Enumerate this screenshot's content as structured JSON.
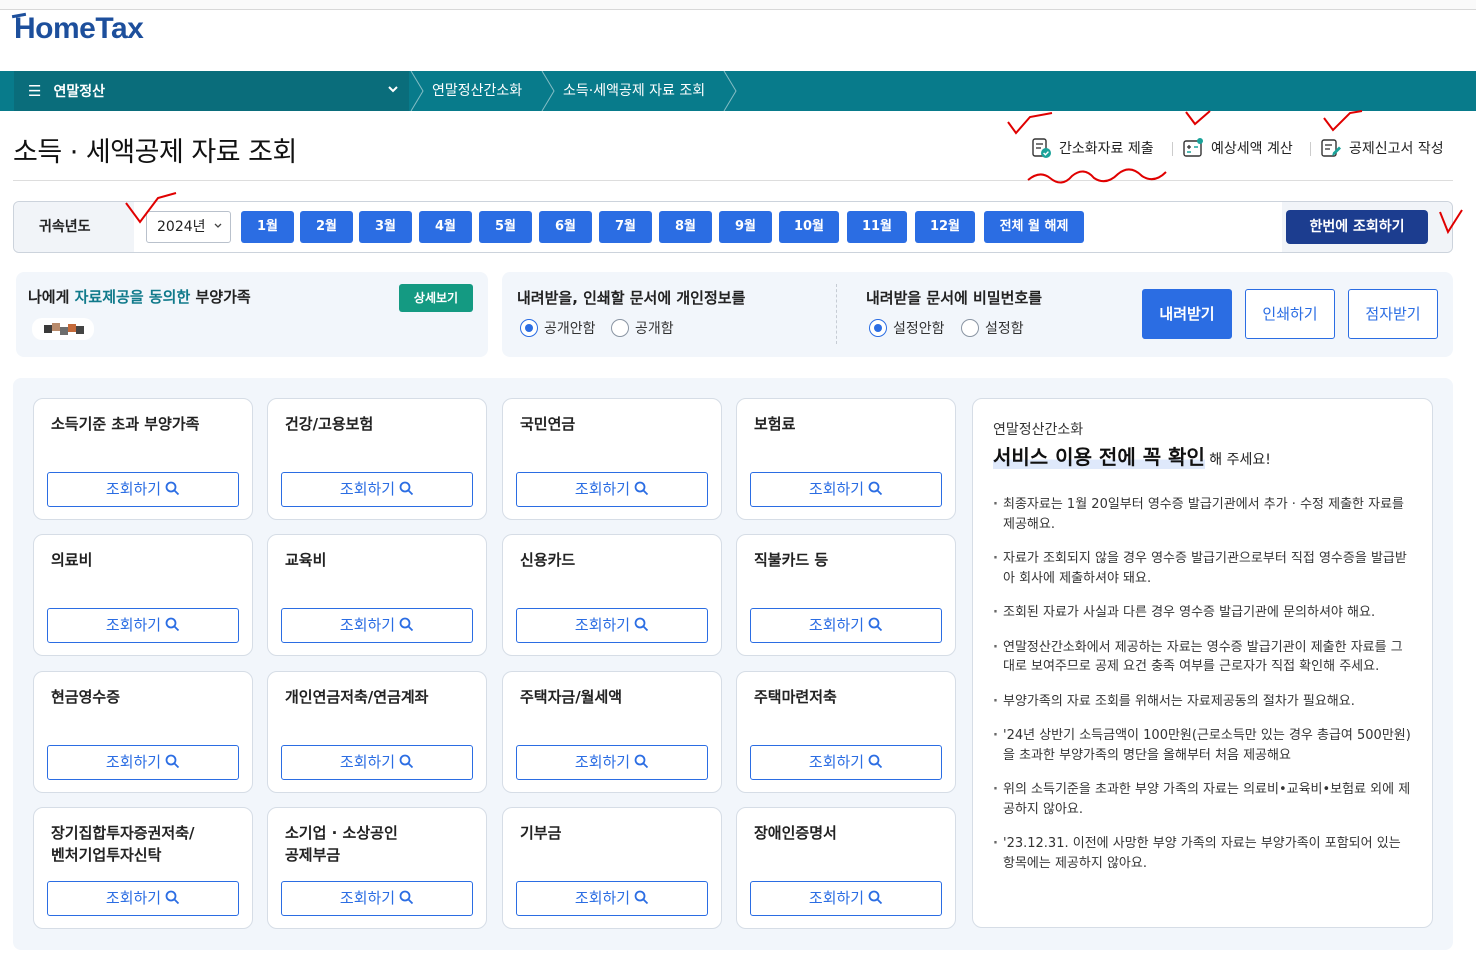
{
  "brand": {
    "logo_text": "HomeTax"
  },
  "nav": {
    "menu_label": "연말정산",
    "breadcrumbs": [
      "연말정산간소화",
      "소득·세액공제 자료 조회"
    ]
  },
  "page": {
    "title": "소득 · 세액공제 자료 조회",
    "quick_links": [
      "간소화자료 제출",
      "예상세액 계산",
      "공제신고서 작성"
    ]
  },
  "year_filter": {
    "label": "귀속년도",
    "selected_year": "2024년",
    "months": [
      "1월",
      "2월",
      "3월",
      "4월",
      "5월",
      "6월",
      "7월",
      "8월",
      "9월",
      "10월",
      "11월",
      "12월"
    ],
    "clear_all_label": "전체 월 해제",
    "query_all_label": "한번에 조회하기"
  },
  "consent": {
    "prefix": "나에게 ",
    "highlight": "자료제공을 동의한",
    "suffix": " 부양가족",
    "detail_label": "상세보기"
  },
  "privacy": {
    "title": "내려받을, 인쇄할 문서에 개인정보를",
    "options": [
      "공개안함",
      "공개함"
    ],
    "selected": "공개안함"
  },
  "password": {
    "title": "내려받을 문서에 비밀번호를",
    "options": [
      "설정안함",
      "설정함"
    ],
    "selected": "설정안함"
  },
  "actions": {
    "download": "내려받기",
    "print": "인쇄하기",
    "braille": "점자받기"
  },
  "query_label": "조회하기",
  "cards": [
    [
      "소득기준 초과 부양가족"
    ],
    [
      "건강/고용보험"
    ],
    [
      "국민연금"
    ],
    [
      "보험료"
    ],
    [
      "의료비"
    ],
    [
      "교육비"
    ],
    [
      "신용카드"
    ],
    [
      "직불카드 등"
    ],
    [
      "현금영수증"
    ],
    [
      "개인연금저축/연금계좌"
    ],
    [
      "주택자금/월세액"
    ],
    [
      "주택마련저축"
    ],
    [
      "장기집합투자증권저축/",
      "벤처기업투자신탁"
    ],
    [
      "소기업 · 소상공인",
      "공제부금"
    ],
    [
      "기부금"
    ],
    [
      "장애인증명서"
    ]
  ],
  "notice": {
    "subtitle": "연말정산간소화",
    "heading": "서비스 이용 전에 꼭 확인",
    "heading_tail": " 해 주세요!",
    "items": [
      "최종자료는 1월 20일부터 영수증 발급기관에서 추가 · 수정 제출한 자료를 제공해요.",
      "자료가 조회되지 않을 경우 영수증 발급기관으로부터 직접 영수증을 발급받아 회사에 제출하셔야 돼요.",
      "조회된 자료가 사실과 다른 경우 영수증 발급기관에 문의하셔야 해요.",
      "연말정산간소화에서 제공하는 자료는 영수증 발급기관이 제출한 자료를 그대로 보여주므로 공제 요건 충족 여부를 근로자가 직접 확인해 주세요.",
      "부양가족의 자료 조회를 위해서는 자료제공동의 절차가 필요해요.",
      "'24년 상반기 소득금액이 100만원(근로소득만 있는 경우 총급여 500만원)을 초과한 부양가족의 명단을 올해부터 처음 제공해요",
      "위의 소득기준을 초과한 부양 가족의 자료는 의료비•교육비•보험료 외에 제공하지 않아요.",
      "'23.12.31. 이전에 사망한 부양 가족의 자료는 부양가족이 포함되어 있는 항목에는 제공하지 않아요."
    ]
  },
  "colors": {
    "nav_teal": "#087b8b",
    "primary_blue": "#2b6de3",
    "navy": "#1c3d8f",
    "consent_green": "#149a82",
    "annotation_red": "#e00000"
  }
}
